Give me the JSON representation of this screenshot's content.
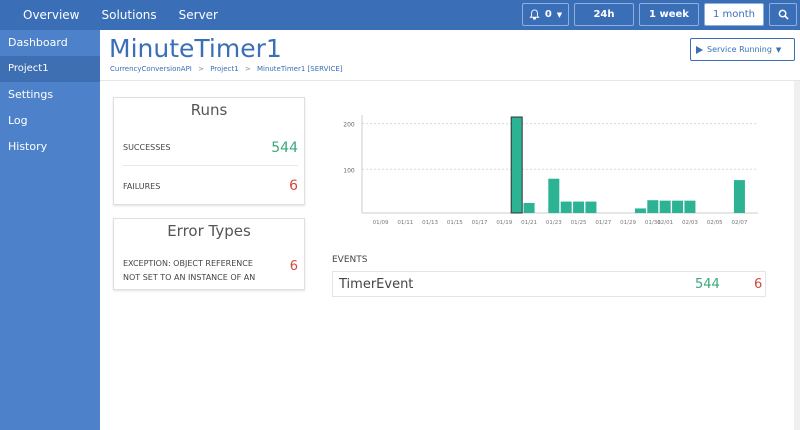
{
  "topnav": {
    "items": [
      "Overview",
      "Solutions",
      "Server"
    ]
  },
  "notifications": {
    "count": "0"
  },
  "ranges": [
    "24h",
    "1 week",
    "1 month"
  ],
  "sidebar": {
    "items": [
      "Dashboard",
      "Project1",
      "Settings",
      "Log",
      "History"
    ]
  },
  "page": {
    "title": "MinuteTimer1",
    "breadcrumb": [
      "CurrencyConversionAPI",
      ">",
      "Project1",
      ">",
      "MinuteTimer1 [SERVICE]"
    ]
  },
  "service_button": {
    "label": "Service Running"
  },
  "runs": {
    "title": "Runs",
    "successes_label": "SUCCESSES",
    "successes_value": "544",
    "failures_label": "FAILURES",
    "failures_value": "6"
  },
  "error_types": {
    "title": "Error Types",
    "items": [
      {
        "message": "EXCEPTION: OBJECT REFERENCE NOT SET TO AN INSTANCE OF AN",
        "count": "6"
      }
    ]
  },
  "events": {
    "label": "EVENTS",
    "rows": [
      {
        "name": "TimerEvent",
        "successes": "544",
        "failures": "6"
      }
    ]
  },
  "colors": {
    "accent": "#3a6fb8",
    "sidebar": "#4d82ca",
    "success": "#3aa87a",
    "failure": "#d04a3a",
    "bar": "#2bb394"
  },
  "chart_data": {
    "type": "bar",
    "tick_labels": [
      "01/09",
      "01/11",
      "01/13",
      "01/15",
      "01/17",
      "01/19",
      "01/21",
      "01/23",
      "01/25",
      "01/27",
      "01/29",
      "01/31",
      "02/01",
      "02/03",
      "02/05",
      "02/07"
    ],
    "yticks": [
      100,
      200
    ],
    "ylim": [
      0,
      210
    ],
    "bars": [
      {
        "x": 20.5,
        "value": 210
      },
      {
        "x": 21.5,
        "value": 22
      },
      {
        "x": 23.5,
        "value": 75
      },
      {
        "x": 24.5,
        "value": 25
      },
      {
        "x": 25.5,
        "value": 25
      },
      {
        "x": 26.5,
        "value": 25
      },
      {
        "x": 30.5,
        "value": 10
      },
      {
        "x": 31.5,
        "value": 28
      },
      {
        "x": 32.5,
        "value": 27
      },
      {
        "x": 33.5,
        "value": 27
      },
      {
        "x": 34.5,
        "value": 27
      },
      {
        "x": 38.5,
        "value": 72
      }
    ],
    "grid": true
  }
}
